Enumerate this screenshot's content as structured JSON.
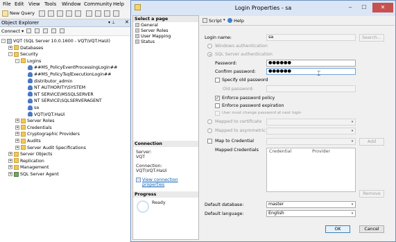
{
  "menubar": {
    "items": [
      "File",
      "Edit",
      "View",
      "Tools",
      "Window",
      "Community",
      "Help"
    ]
  },
  "toolbar": {
    "new_query_label": "New Query"
  },
  "object_explorer": {
    "title": "Object Explorer",
    "connect_label": "Connect ▾",
    "tree": [
      {
        "label": "VQT (SQL Server 10.0.1600 - VQT\\VQT.HaUi)",
        "icon": "server-icon",
        "exp": "-"
      },
      {
        "label": "Databases",
        "icon": "folder-icon",
        "exp": "+"
      },
      {
        "label": "Security",
        "icon": "folder-icon",
        "exp": "-"
      },
      {
        "label": "Logins",
        "icon": "folder-icon",
        "exp": "-"
      },
      {
        "label": "##MS_PolicyEventProcessingLogin##",
        "icon": "user-icon"
      },
      {
        "label": "##MS_PolicyTsqlExecutionLogin##",
        "icon": "user-icon"
      },
      {
        "label": "distributor_admin",
        "icon": "user-icon"
      },
      {
        "label": "NT AUTHORITY\\SYSTEM",
        "icon": "user-icon"
      },
      {
        "label": "NT SERVICE\\MSSQLSERVER",
        "icon": "user-icon"
      },
      {
        "label": "NT SERVICE\\SQLSERVERAGENT",
        "icon": "user-icon"
      },
      {
        "label": "sa",
        "icon": "user-icon"
      },
      {
        "label": "VQT\\VQT.HaUi",
        "icon": "user-icon"
      },
      {
        "label": "Server Roles",
        "icon": "folder-icon",
        "exp": "+"
      },
      {
        "label": "Credentials",
        "icon": "folder-icon",
        "exp": "+"
      },
      {
        "label": "Cryptographic Providers",
        "icon": "folder-icon",
        "exp": "+"
      },
      {
        "label": "Audits",
        "icon": "folder-icon",
        "exp": "+"
      },
      {
        "label": "Server Audit Specifications",
        "icon": "folder-icon",
        "exp": "+"
      },
      {
        "label": "Server Objects",
        "icon": "folder-icon",
        "exp": "+"
      },
      {
        "label": "Replication",
        "icon": "folder-icon",
        "exp": "+"
      },
      {
        "label": "Management",
        "icon": "folder-icon",
        "exp": "+"
      },
      {
        "label": "SQL Server Agent",
        "icon": "agent-icon",
        "exp": "+"
      }
    ]
  },
  "dialog": {
    "title": "Login Properties - sa",
    "select_page": {
      "header": "Select a page",
      "pages": [
        "General",
        "Server Roles",
        "User Mapping",
        "Status"
      ]
    },
    "connection": {
      "header": "Connection",
      "server_label": "Server:",
      "server_value": "VQT",
      "conn_label": "Connection:",
      "conn_value": "VQT\\VQT.HaUi",
      "view_link": "View connection properties"
    },
    "progress": {
      "header": "Progress",
      "status": "Ready"
    },
    "toolbar": {
      "script_label": "Script",
      "help_label": "Help"
    },
    "login_name_label": "Login name:",
    "login_name_value": "sa",
    "search_button": "Search...",
    "windows_auth_label": "Windows authentication",
    "sql_auth_label": "SQL Server authentication",
    "password_label": "Password:",
    "password_value": "●●●●●●",
    "confirm_label": "Confirm password:",
    "confirm_value": "●●●●●●",
    "specify_old_label": "Specify old password",
    "old_password_label": "Old password:",
    "enforce_policy_label": "Enforce password policy",
    "enforce_expiration_label": "Enforce password expiration",
    "must_change_label": "User must change password at next login",
    "mapped_cert_label": "Mapped to certificate",
    "mapped_key_label": "Mapped to asymmetric key",
    "map_credential_label": "Map to Credential",
    "add_button": "Add",
    "mapped_credentials_label": "Mapped Credentials",
    "cred_columns": [
      "Credential",
      "Provider"
    ],
    "remove_button": "Remove",
    "default_db_label": "Default database:",
    "default_db_value": "master",
    "default_lang_label": "Default language:",
    "default_lang_value": "English",
    "ok_button": "OK",
    "cancel_button": "Cancel",
    "enforce_policy_checked": true,
    "enforce_expiration_checked": false,
    "specify_old_checked": false,
    "map_credential_checked": false
  },
  "colors": {
    "titlebar": "#dae6f5",
    "close": "#c75050",
    "link": "#0b5fb3"
  }
}
